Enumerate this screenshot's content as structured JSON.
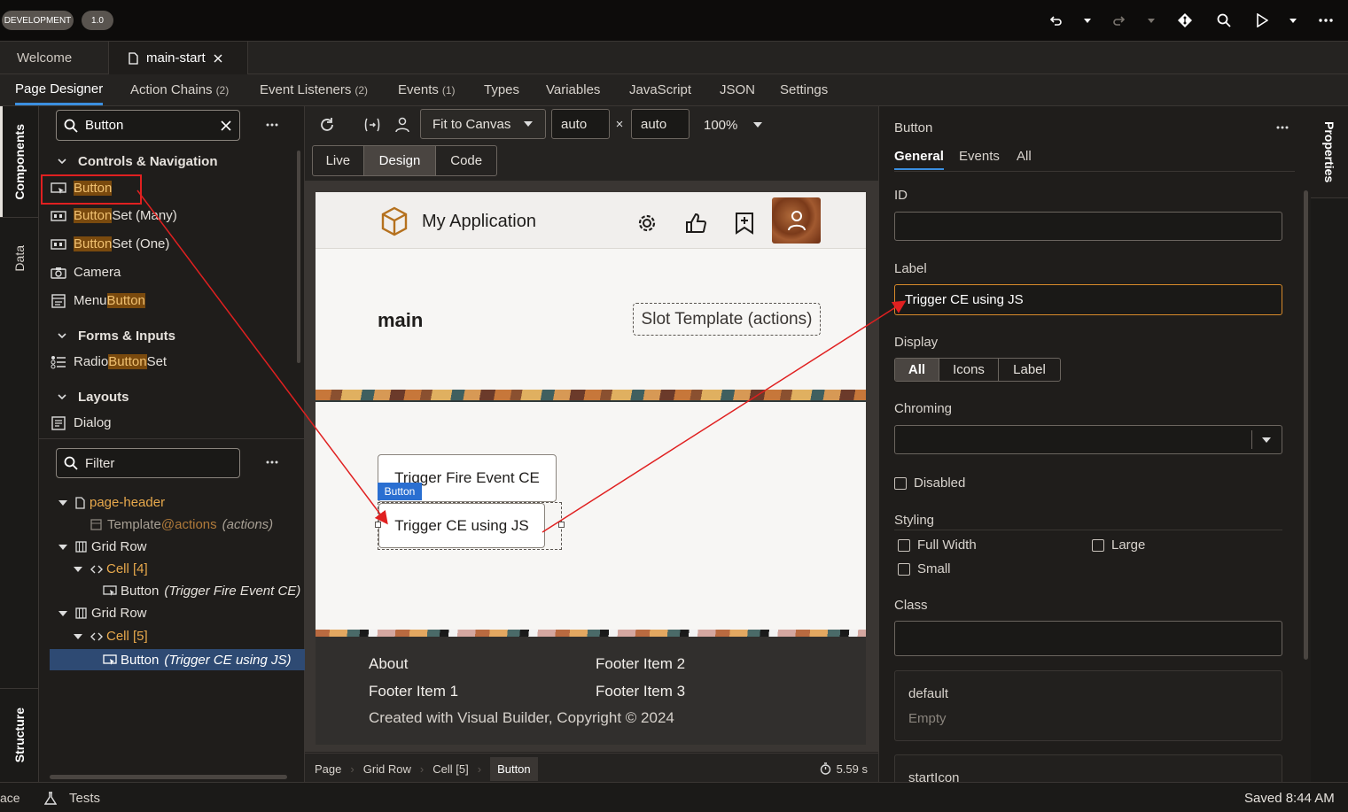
{
  "topbar": {
    "env_badge": "DEVELOPMENT",
    "version_badge": "1.0"
  },
  "file_tabs": {
    "welcome": "Welcome",
    "main_start": "main-start"
  },
  "designer_tabs": {
    "page_designer": "Page Designer",
    "action_chains": "Action Chains",
    "action_chains_count": "(2)",
    "event_listeners": "Event Listeners",
    "event_listeners_count": "(2)",
    "events": "Events",
    "events_count": "(1)",
    "types": "Types",
    "variables": "Variables",
    "javascript": "JavaScript",
    "json": "JSON",
    "settings": "Settings"
  },
  "left_rail": {
    "components": "Components",
    "data": "Data",
    "structure": "Structure"
  },
  "components": {
    "search_value": "Button",
    "groups": {
      "controls": "Controls & Navigation",
      "forms": "Forms & Inputs",
      "layouts": "Layouts"
    },
    "items": {
      "button_hl": "Button",
      "button_set_many_hl": "Button",
      "button_set_many_rest": " Set (Many)",
      "button_set_one_hl": "Button",
      "button_set_one_rest": " Set (One)",
      "camera": "Camera",
      "menu_button_pre": "Menu ",
      "menu_button_hl": "Button",
      "radio_pre": "Radio ",
      "radio_hl": "Button",
      "radio_rest": " Set",
      "dialog": "Dialog"
    }
  },
  "structure": {
    "filter_placeholder": "Filter",
    "page_header": "page-header",
    "template": "Template",
    "template_slot": "@actions",
    "template_note": "(actions)",
    "grid_row_1": "Grid Row",
    "cell_4": "Cell [4]",
    "button_1": "Button",
    "button_1_note": "(Trigger Fire Event CE)",
    "grid_row_2": "Grid Row",
    "cell_5": "Cell [5]",
    "button_2": "Button",
    "button_2_note": "(Trigger CE using JS)"
  },
  "toolbar": {
    "fit": "Fit to Canvas",
    "width": "auto",
    "times": "×",
    "height": "auto",
    "zoom": "100%",
    "modes": {
      "live": "Live",
      "design": "Design",
      "code": "Code"
    }
  },
  "canvas": {
    "app_title": "My Application",
    "main_title": "main",
    "slot_template": "Slot Template (actions)",
    "button_fire": "Trigger Fire Event CE",
    "button_tag": "Button",
    "button_js": "Trigger CE using JS",
    "footer": {
      "about": "About",
      "item1": "Footer Item 1",
      "item2": "Footer Item 2",
      "item3": "Footer Item 3",
      "copyright": "Created with Visual Builder, Copyright © 2024"
    }
  },
  "breadcrumb": {
    "page": "Page",
    "grid_row": "Grid Row",
    "cell": "Cell [5]",
    "button": "Button",
    "timer": "5.59 s"
  },
  "properties": {
    "title": "Button",
    "tabs": {
      "general": "General",
      "events": "Events",
      "all": "All"
    },
    "id_label": "ID",
    "id_value": "",
    "label_label": "Label",
    "label_value": "Trigger CE using JS",
    "display_label": "Display",
    "display_options": {
      "all": "All",
      "icons": "Icons",
      "label": "Label"
    },
    "chroming_label": "Chroming",
    "disabled": "Disabled",
    "styling_label": "Styling",
    "full_width": "Full Width",
    "large": "Large",
    "small": "Small",
    "class_label": "Class",
    "default_slot": "default",
    "default_value": "Empty",
    "start_icon": "startIcon"
  },
  "right_rail": {
    "properties": "Properties"
  },
  "statusbar": {
    "left": "ace",
    "tests": "Tests",
    "saved": "Saved 8:44 AM"
  }
}
